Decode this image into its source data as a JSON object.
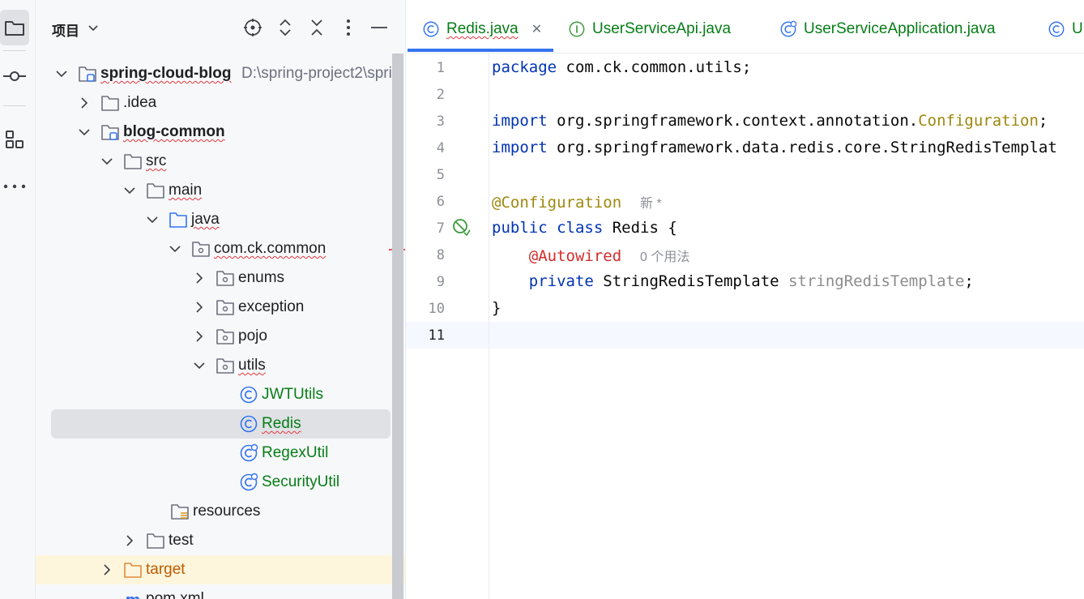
{
  "project_panel": {
    "title": "项目",
    "tree": [
      {
        "label": "spring-cloud-blog",
        "path": "D:\\spring-project2\\spri"
      },
      {
        "label": ".idea"
      },
      {
        "label": "blog-common"
      },
      {
        "label": "src"
      },
      {
        "label": "main"
      },
      {
        "label": "java"
      },
      {
        "label": "com.ck.common"
      },
      {
        "label": "enums"
      },
      {
        "label": "exception"
      },
      {
        "label": "pojo"
      },
      {
        "label": "utils"
      },
      {
        "label": "JWTUtils"
      },
      {
        "label": "Redis"
      },
      {
        "label": "RegexUtil"
      },
      {
        "label": "SecurityUtil"
      },
      {
        "label": "resources"
      },
      {
        "label": "test"
      },
      {
        "label": "target"
      },
      {
        "label": "pom.xml"
      }
    ]
  },
  "tabs": [
    {
      "label": "Redis.java"
    },
    {
      "label": "UserServiceApi.java"
    },
    {
      "label": "UserServiceApplication.java"
    },
    {
      "label": "U"
    }
  ],
  "editor": {
    "line_numbers": [
      "1",
      "2",
      "3",
      "4",
      "5",
      "6",
      "7",
      "8",
      "9",
      "10",
      "11"
    ],
    "code": {
      "l1_kw": "package",
      "l1_rest": " com.ck.common.utils;",
      "l3_kw": "import",
      "l3_rest": " org.springframework.context.annotation.",
      "l3_ann": "Configuration",
      "l3_end": ";",
      "l4_kw": "import",
      "l4_rest": " org.springframework.data.redis.core.StringRedisTemplat",
      "l6_ann": "@Configuration",
      "l6_hint": "新 *",
      "l7_kw1": "public",
      "l7_kw2": "class",
      "l7_rest": " Redis {",
      "l8_ann": "@Autowired",
      "l8_hint": "0 个用法",
      "l9_kw": "private",
      "l9_type": " StringRedisTemplate ",
      "l9_field": "stringRedisTemplate",
      "l9_end": ";",
      "l10": "}"
    }
  },
  "colors": {
    "keyword": "#0033b3",
    "annotation": "#9e880d",
    "accent": "#3574f0",
    "error_underline": "#e0383e",
    "class_green": "#067d17"
  }
}
